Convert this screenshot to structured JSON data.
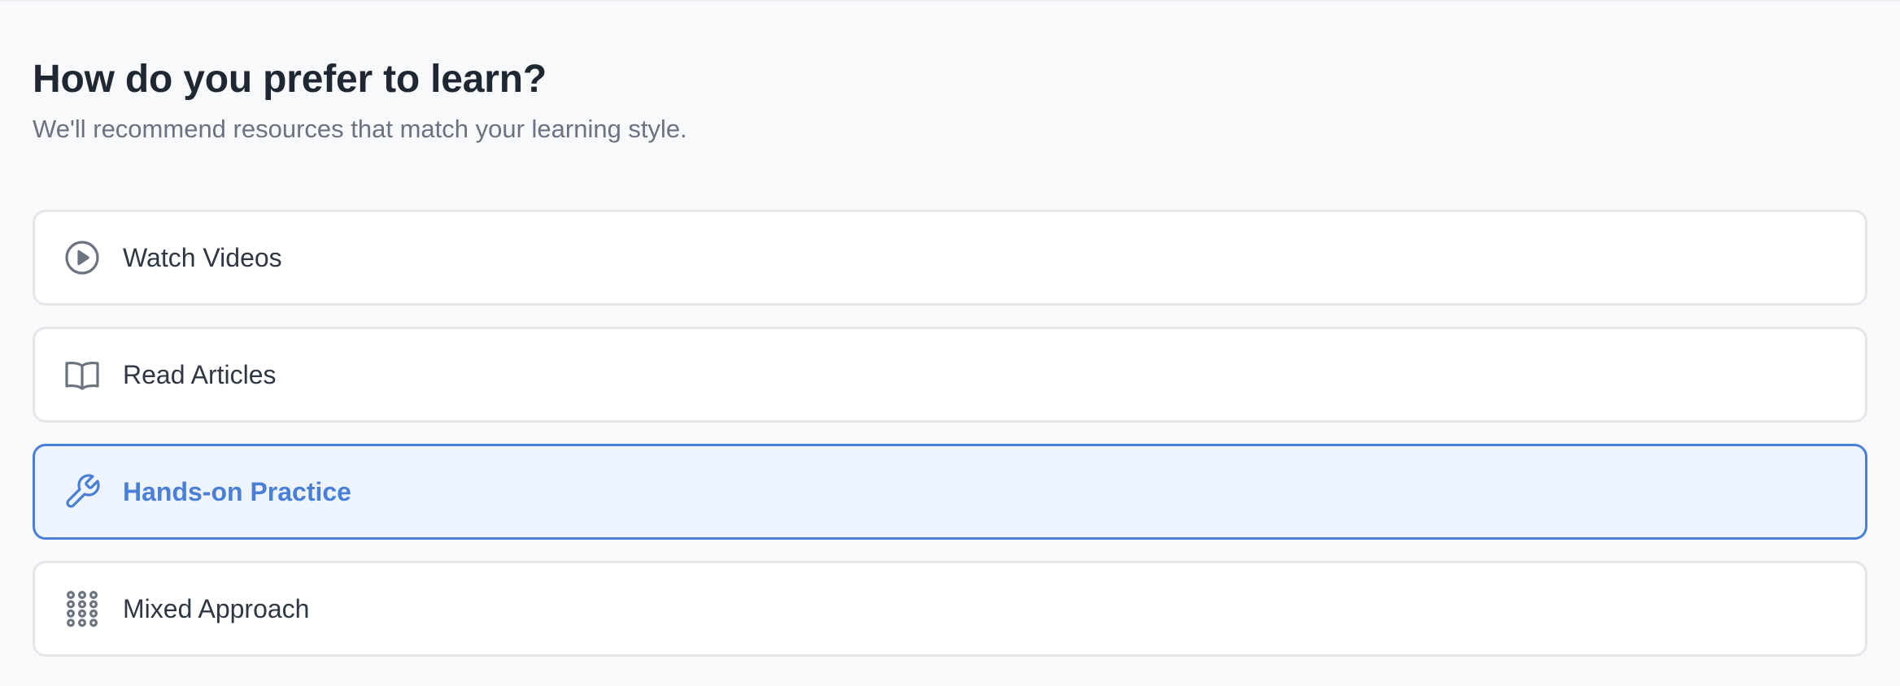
{
  "header": {
    "title": "How do you prefer to learn?",
    "subtitle": "We'll recommend resources that match your learning style."
  },
  "options": [
    {
      "label": "Watch Videos",
      "icon": "play-circle-icon",
      "selected": false
    },
    {
      "label": "Read Articles",
      "icon": "open-book-icon",
      "selected": false
    },
    {
      "label": "Hands-on Practice",
      "icon": "wrench-icon",
      "selected": true
    },
    {
      "label": "Mixed Approach",
      "icon": "grid-dots-icon",
      "selected": false
    }
  ],
  "colors": {
    "background": "#f8f9fb",
    "title": "#1f2733",
    "subtitle": "#6b7280",
    "card_border": "#e4e6ea",
    "icon": "#6b7280",
    "accent": "#4a7fd7",
    "selected_bg": "#eef4fd"
  }
}
